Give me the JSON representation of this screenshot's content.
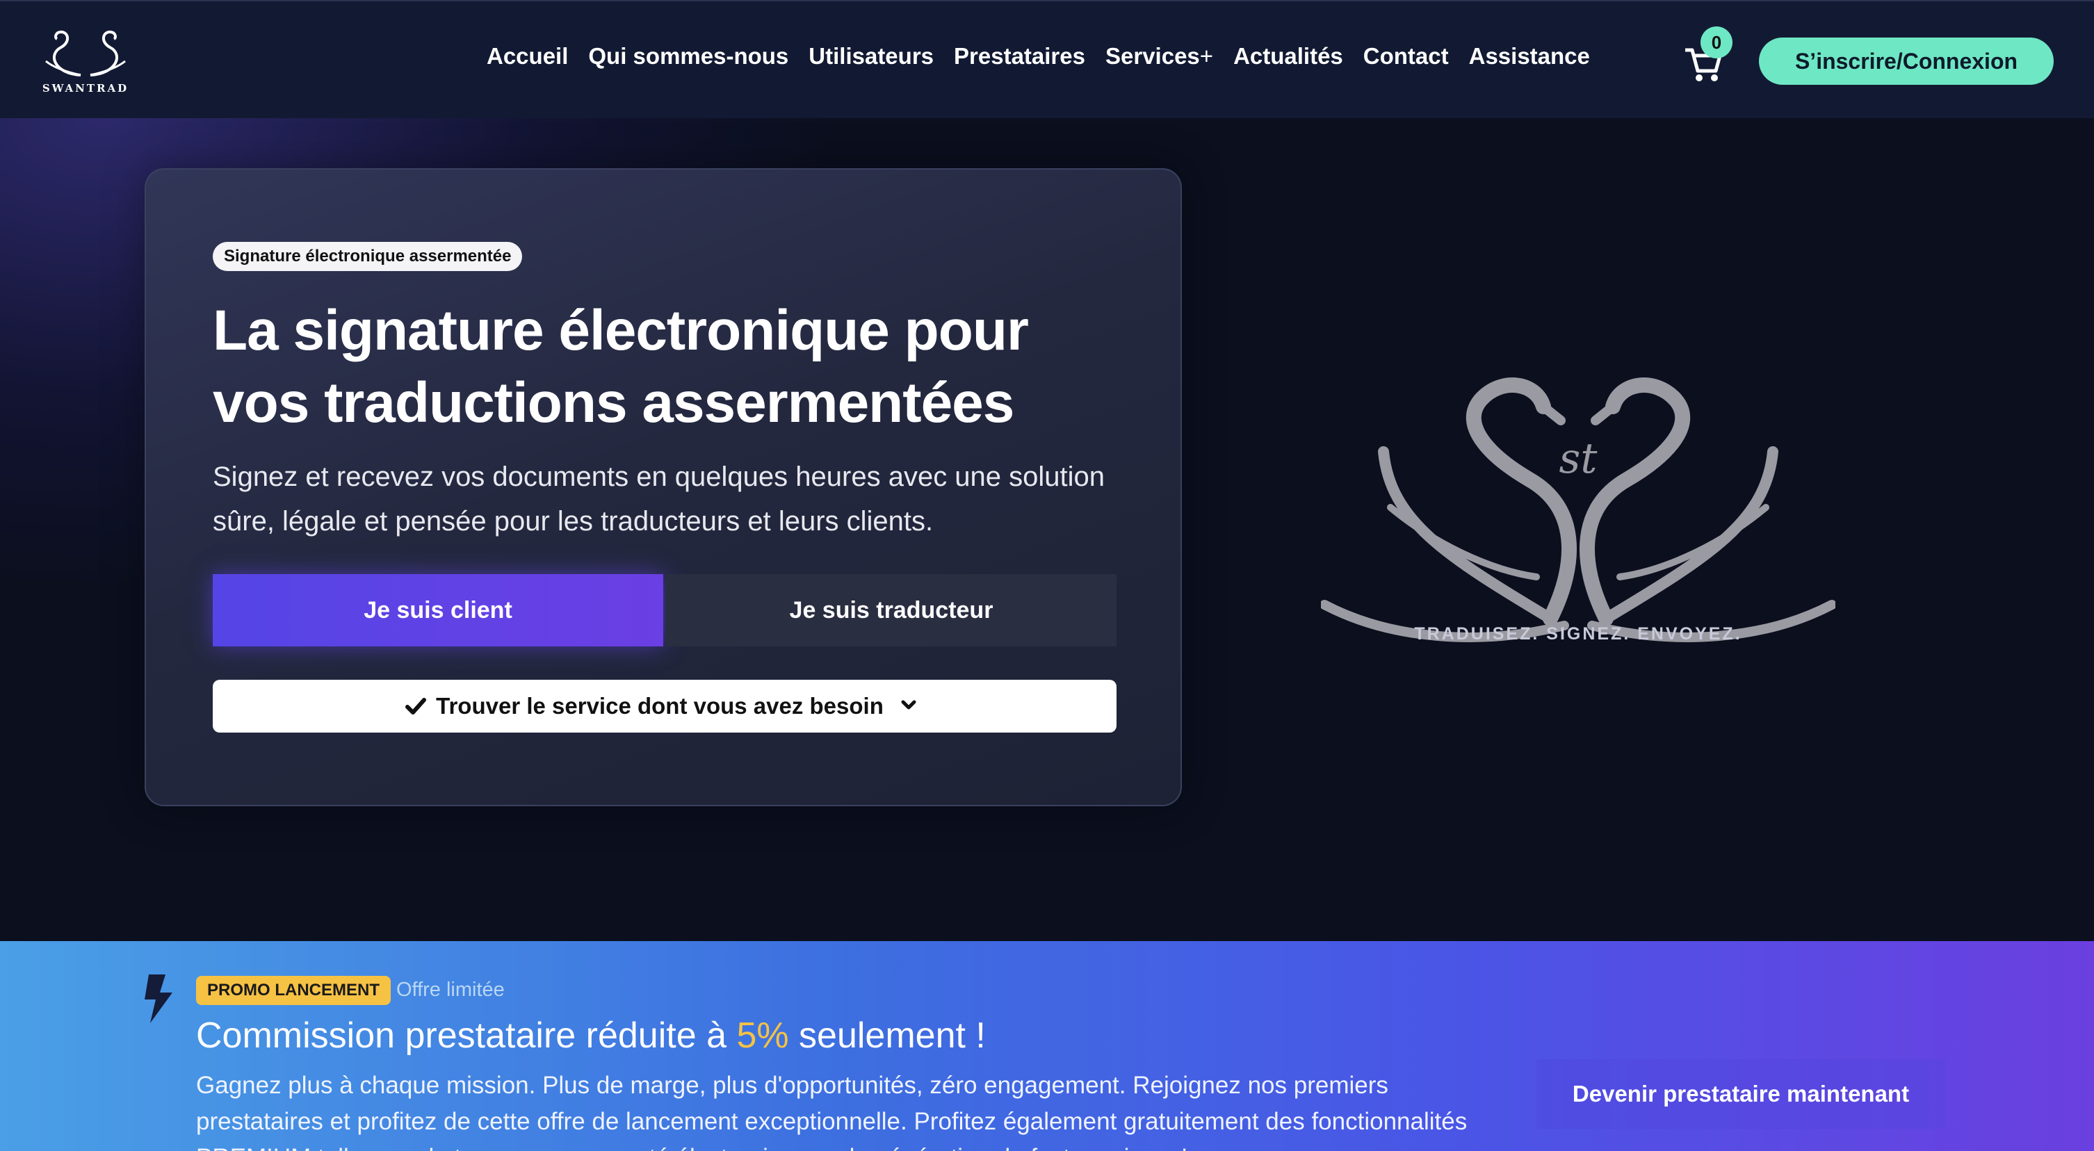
{
  "brand": {
    "name": "SWANTRAD"
  },
  "nav": {
    "items": [
      {
        "label": "Accueil"
      },
      {
        "label": "Qui sommes-nous"
      },
      {
        "label": "Utilisateurs"
      },
      {
        "label": "Prestataires"
      },
      {
        "label": "Services"
      },
      {
        "label": "Actualités"
      },
      {
        "label": "Contact"
      },
      {
        "label": "Assistance"
      }
    ],
    "services_plus": "+",
    "cart_count": "0",
    "login_label": "S’inscrire/Connexion"
  },
  "hero": {
    "badge": "Signature électronique assermentée",
    "title": "La signature électronique pour vos traductions assermentées",
    "subtitle": "Signez et recevez vos documents en quelques heures avec une solution sûre, légale et pensée pour les traducteurs et leurs clients.",
    "btn_client": "Je suis client",
    "btn_translator": "Je suis traducteur",
    "service_select": "Trouver le service dont vous avez besoin",
    "tagline": "TRADUISEZ. SIGNEZ. ENVOYEZ."
  },
  "promo": {
    "tag": "PROMO LANCEMENT",
    "limited": "Offre limitée",
    "title_before": "Commission prestataire réduite à ",
    "title_highlight": "5%",
    "title_after": " seulement !",
    "text": "Gagnez plus à chaque mission. Plus de marge, plus d'opportunités, zéro engagement. Rejoignez nos premiers prestataires et profitez de cette offre de lancement exceptionnelle. Profitez également gratuitement des fonctionnalités PREMIUM telles que le tampon assermenté électronique ou la génération de factures jusqu'au",
    "cta": "Devenir prestataire maintenant"
  },
  "colors": {
    "accent_mint": "#6ee7c4",
    "accent_purple": "#5545e6",
    "promo_yellow": "#f6c244",
    "nav_bg": "#121a33"
  },
  "icons": {
    "cart": "cart-icon",
    "check": "check-icon",
    "chevron": "chevron-down-icon",
    "bolt": "lightning-icon"
  }
}
